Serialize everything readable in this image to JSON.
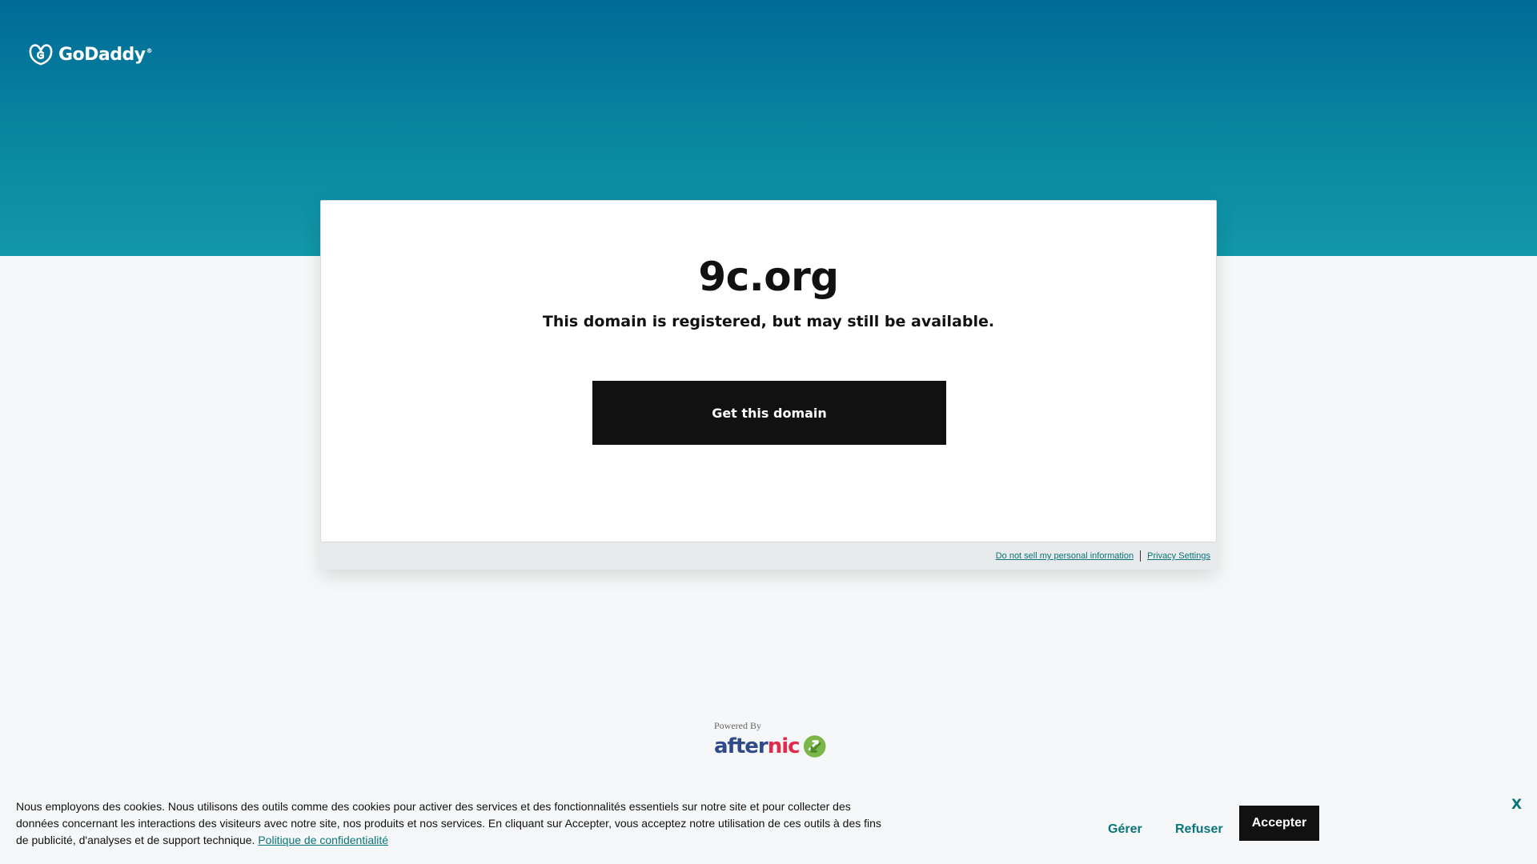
{
  "header": {
    "logo_text": "GoDaddy",
    "logo_tm": "®"
  },
  "card": {
    "domain": "9c.org",
    "subtitle": "This domain is registered, but may still be available.",
    "cta_label": "Get this domain"
  },
  "card_footer": {
    "links": [
      {
        "label": "Do not sell my personal information"
      },
      {
        "label": "Privacy Settings"
      }
    ]
  },
  "powered_by": {
    "label": "Powered By",
    "brand_after": "after",
    "brand_nic": "nic"
  },
  "cookie_banner": {
    "text": "Nous employons des cookies. Nous utilisons des outils comme des cookies pour activer des services et des fonctionnalités essentiels sur notre site et pour collecter des données concernant les interactions des visiteurs avec notre site, nos produits et nos services. En cliquant sur Accepter, vous acceptez notre utilisation de ces outils à des fins de publicité, d'analyses et de support technique.",
    "policy_link": "Politique de confidentialité",
    "manage_label": "Gérer",
    "refuse_label": "Refuser",
    "accept_label": "Accepter",
    "close_label": "X"
  },
  "colors": {
    "hero_top": "#006a97",
    "hero_bottom": "#1297a8",
    "link_teal": "#09757a",
    "button_dark": "#111111",
    "afternic_blue": "#2f4a8a",
    "afternic_red": "#e5294a"
  }
}
